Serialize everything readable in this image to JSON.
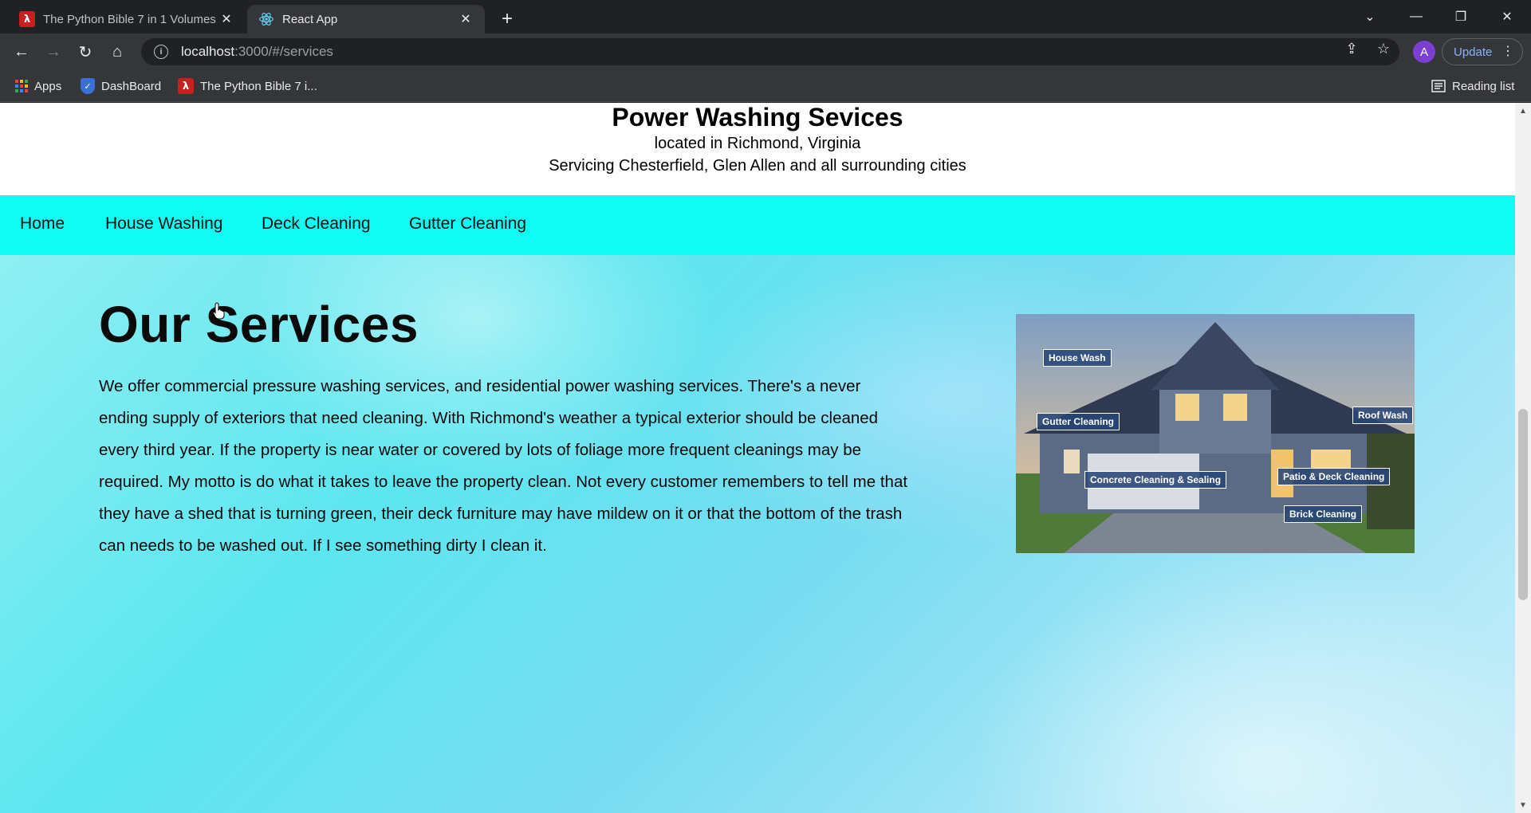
{
  "browser": {
    "tabs": [
      {
        "title": "The Python Bible 7 in 1 Volumes",
        "icon": "pdf-icon"
      },
      {
        "title": "React App",
        "icon": "react-icon",
        "active": true
      }
    ],
    "url_host": "localhost",
    "url_rest": ":3000/#/services",
    "avatar_letter": "A",
    "update_label": "Update",
    "bookmarks": [
      {
        "label": "Apps",
        "icon": "apps-grid-icon"
      },
      {
        "label": "DashBoard",
        "icon": "shield-icon"
      },
      {
        "label": "The Python Bible 7 i...",
        "icon": "pdf-icon"
      }
    ],
    "reading_list_label": "Reading list"
  },
  "site": {
    "title": "Power Washing Sevices",
    "subtitle1": "located in Richmond, Virginia",
    "subtitle2": "Servicing Chesterfield, Glen Allen and all surrounding cities",
    "nav": [
      "Home",
      "House Washing",
      "Deck Cleaning",
      "Gutter Cleaning"
    ],
    "nav_color": "#10fbf1"
  },
  "services": {
    "heading": "Our Services",
    "body": "We offer commercial pressure washing services, and residential power washing services. There's a never ending supply of exteriors that need cleaning. With Richmond's weather a typical exterior should be cleaned every third year. If the property is near water or covered by lots of foliage more frequent cleanings may be required. My motto is do what it takes to leave the property clean. Not every customer remembers to tell me that they have a shed that is turning green, their deck furniture may have mildew on it or that the bottom of the trash can needs to be washed out. If I see something dirty I clean it.",
    "image_tags": [
      "House Wash",
      "Gutter Cleaning",
      "Roof Wash",
      "Concrete Cleaning & Sealing",
      "Patio & Deck Cleaning",
      "Brick Cleaning"
    ]
  }
}
